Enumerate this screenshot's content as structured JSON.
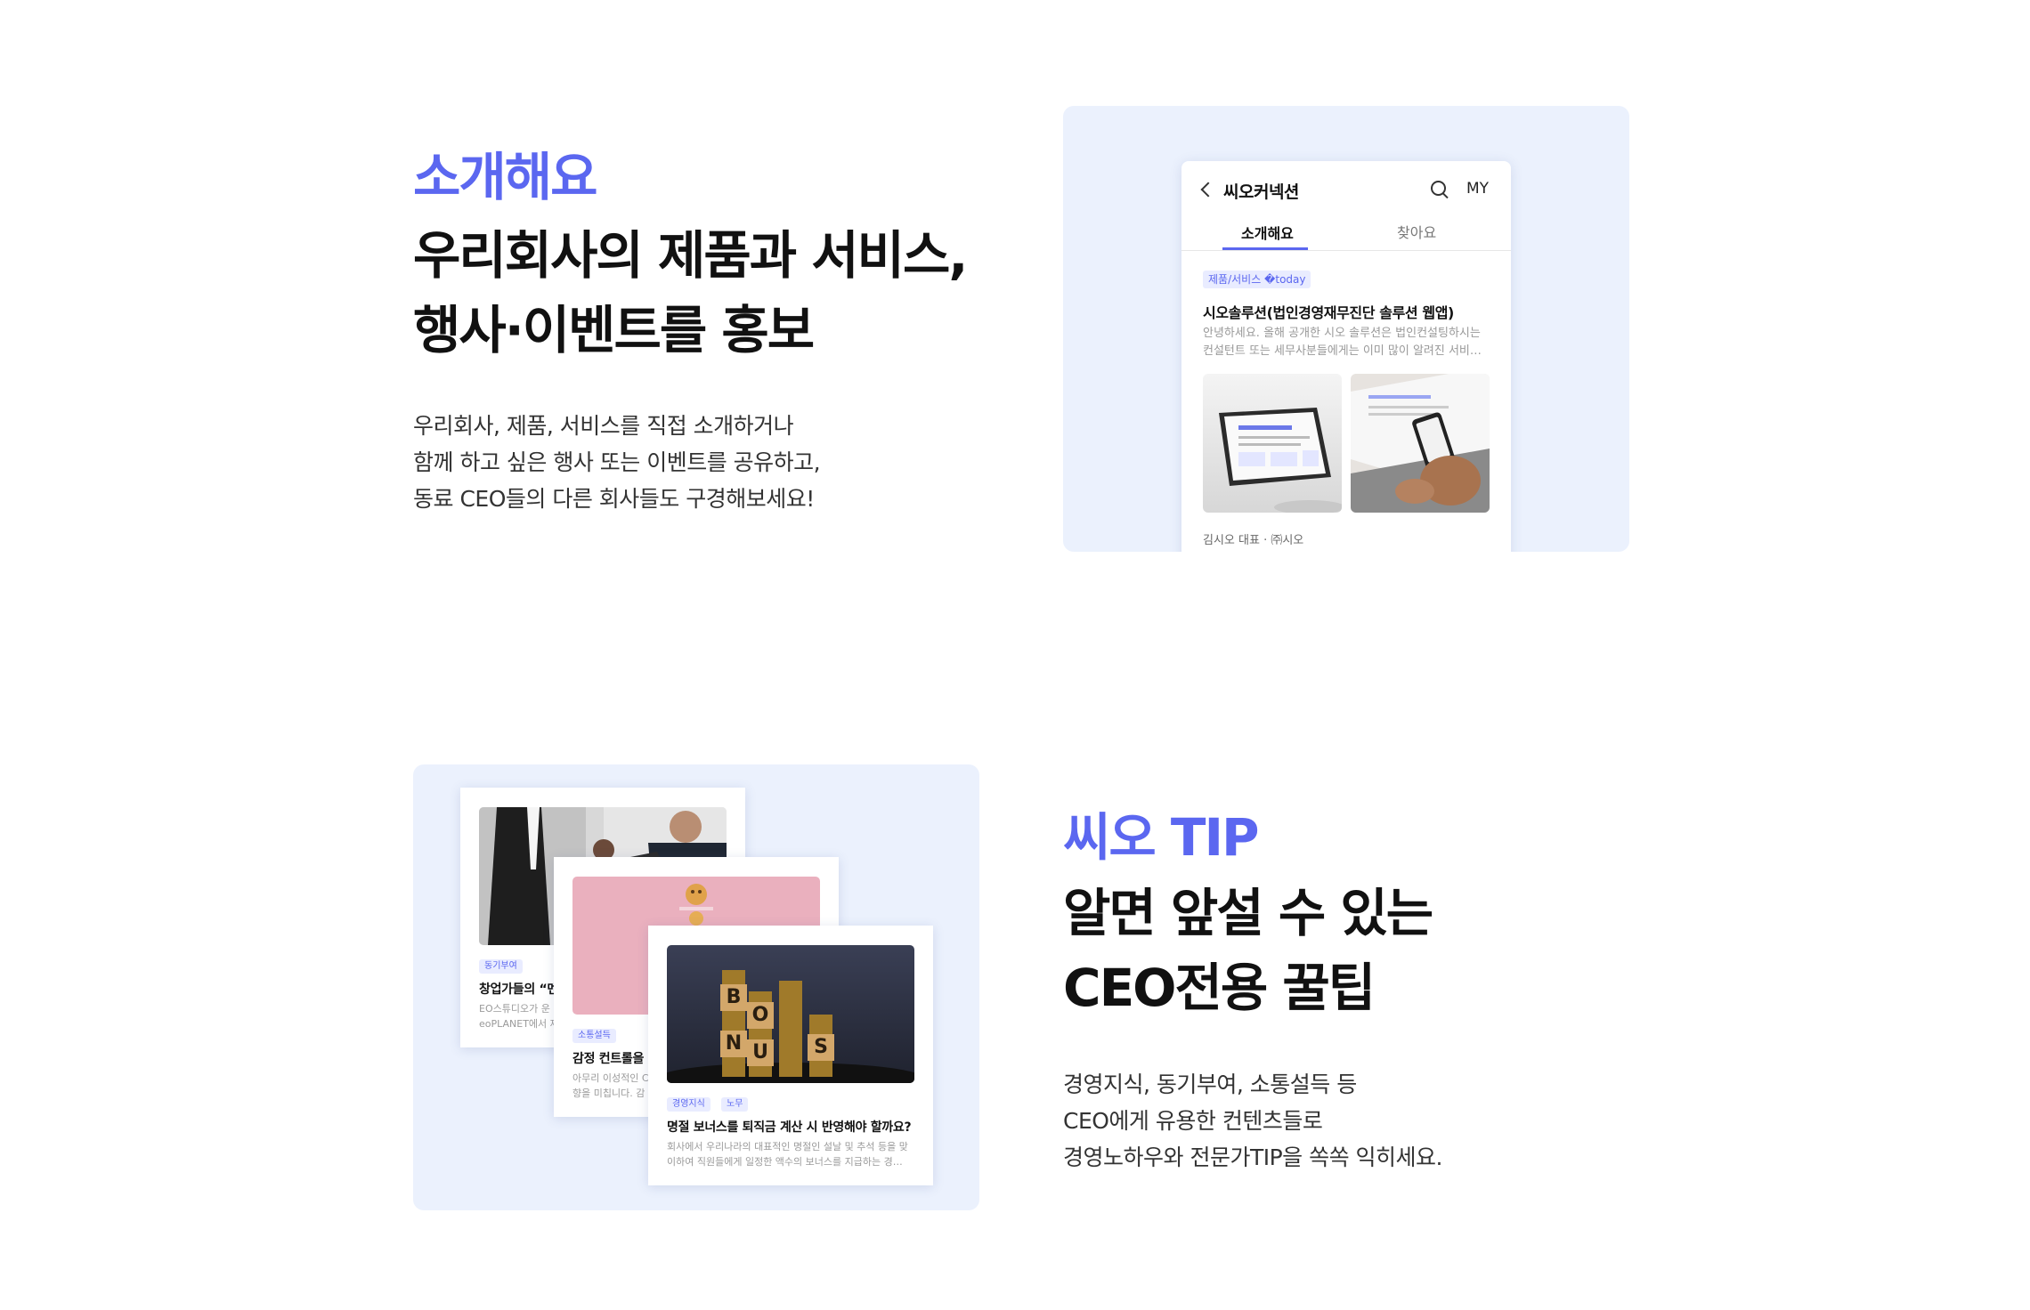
{
  "section1": {
    "eyebrow": "소개해요",
    "headline": [
      "우리회사의 제품과 서비스,",
      "행사·이벤트를 홍보"
    ],
    "description": [
      "우리회사, 제품, 서비스를 직접 소개하거나",
      "함께 하고 싶은 행사 또는 이벤트를 공유하고,",
      "동료 CEO들의 다른 회사들도 구경해보세요!"
    ],
    "preview": {
      "app_title": "씨오커넥션",
      "my_label": "MY",
      "tabs": [
        {
          "label": "소개해요",
          "active": true
        },
        {
          "label": "찾아요",
          "active": false
        }
      ],
      "post": {
        "category": "제품/서비스 �today",
        "title": "시오솔루션(법인경영재무진단 솔루션 웹앱)",
        "excerpt": [
          "안녕하세요. 올해 공개한 시오 솔루션은 법인컨설팅하시는",
          "컨설턴트 또는 세무사분들에게는 이미 많이 알려진 서비스…"
        ],
        "author": "김시오 대표  · ㈜시오"
      },
      "icons": {
        "back": "chevron-left-icon",
        "search": "search-icon"
      }
    }
  },
  "section2": {
    "eyebrow": "씨오 TIP",
    "headline": [
      "알면 앞설 수 있는",
      "CEO전용 꿀팁"
    ],
    "description": [
      "경영지식, 동기부여, 소통설득 등",
      "CEO에게 유용한 컨텐츠들로",
      "경영노하우와 전문가TIP을 쏙쏙 익히세요."
    ],
    "cards": [
      {
        "tags": [
          "동기부여"
        ],
        "title": "창업가들의 “멘",
        "excerpt": [
          "EO스튜디오가 운",
          "eoPLANET에서 제"
        ]
      },
      {
        "tags": [
          "소통설득"
        ],
        "title": "감정 컨트롤을 위",
        "excerpt": [
          "아무리 이성적인 C",
          "향을 미칩니다. 감"
        ]
      },
      {
        "tags": [
          "경영지식",
          "노무"
        ],
        "title": "명절 보너스를 퇴직금 계산 시 반영해야 할까요?",
        "excerpt": [
          "회사에서 우리나라의 대표적인 명절인 설날 및 추석 등을 맞",
          "이하여 직원들에게 일정한 액수의 보너스를 지급하는 경…"
        ]
      }
    ],
    "bonus_letters": [
      "B",
      "O",
      "N",
      "U",
      "S"
    ]
  },
  "colors": {
    "accent": "#5b67f0",
    "panel_bg": "#ebf1fd",
    "text": "#111111"
  }
}
